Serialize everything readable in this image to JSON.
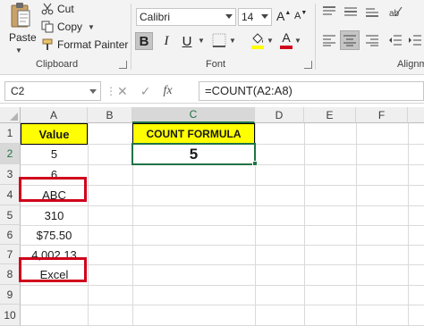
{
  "ribbon": {
    "clipboard": {
      "paste_label": "Paste",
      "cut_label": "Cut",
      "copy_label": "Copy",
      "format_painter_label": "Format Painter",
      "group_label": "Clipboard"
    },
    "font": {
      "font_name": "Calibri",
      "font_size": "14",
      "grow_label": "A",
      "shrink_label": "A",
      "bold_label": "B",
      "italic_label": "I",
      "underline_label": "U",
      "font_color_label": "A",
      "group_label": "Font"
    },
    "alignment": {
      "group_label": "Alignm"
    }
  },
  "formula_bar": {
    "name_box": "C2",
    "fx_label": "fx",
    "formula": "=COUNT(A2:A8)"
  },
  "grid": {
    "columns": [
      "A",
      "B",
      "C",
      "D",
      "E",
      "F"
    ],
    "rows": [
      "1",
      "2",
      "3",
      "4",
      "5",
      "6",
      "7",
      "8",
      "9",
      "10"
    ],
    "cells": {
      "A1": "Value",
      "A2": "5",
      "A3": "6",
      "A4": "ABC",
      "A5": "310",
      "A6": "$75.50",
      "A7": "4,002.13",
      "A8": "Excel",
      "C1": "COUNT FORMULA",
      "C2": "5"
    },
    "selected_cell": "C2"
  },
  "colors": {
    "header_fill": "#ffff00",
    "highlight_border": "#d0021b",
    "selection": "#217346"
  }
}
